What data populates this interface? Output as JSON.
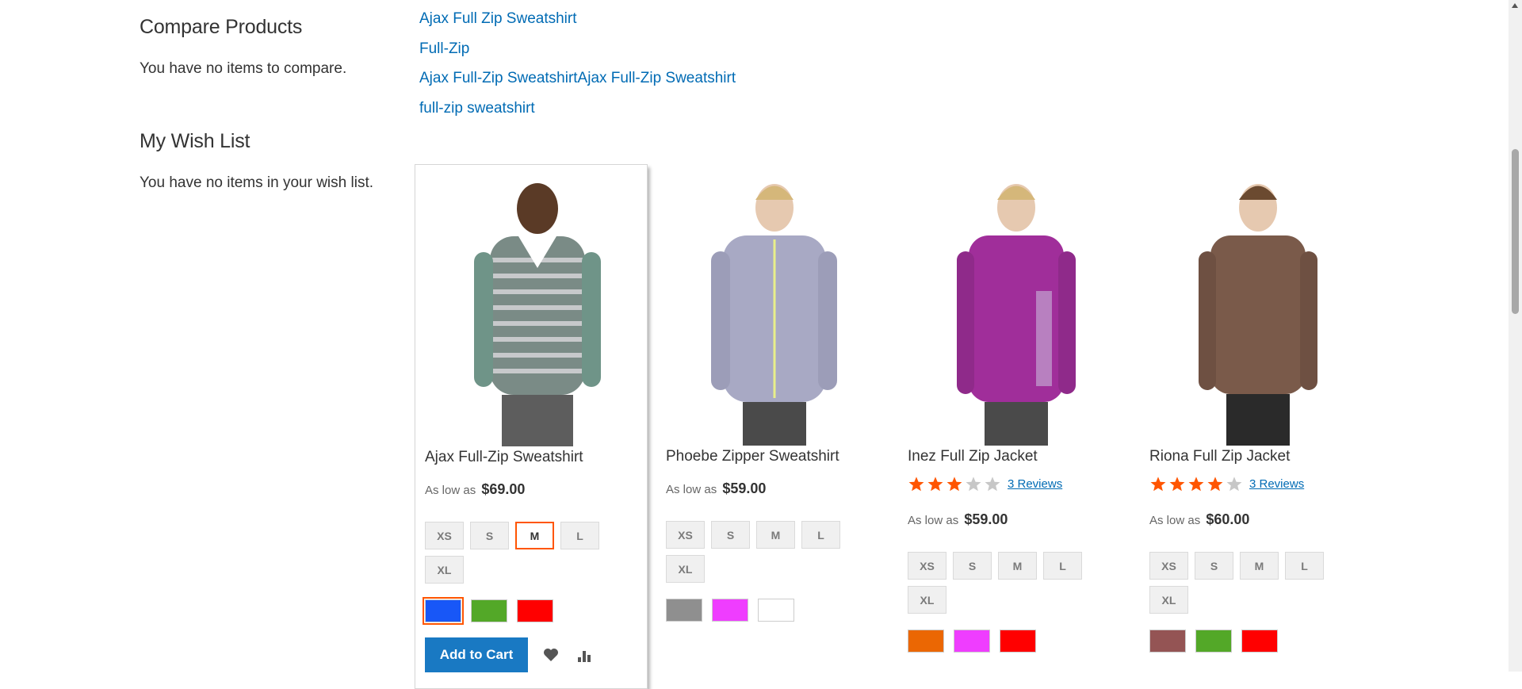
{
  "sidebar": {
    "compare_title": "Compare Products",
    "compare_text": "You have no items to compare.",
    "wishlist_title": "My Wish List",
    "wishlist_text": "You have no items in your wish list."
  },
  "related_searches": [
    "Ajax Full Zip Sweatshirt",
    "Full-Zip",
    "Ajax Full-Zip SweatshirtAjax Full-Zip Sweatshirt",
    "full-zip sweatshirt"
  ],
  "products": [
    {
      "name": "Ajax Full-Zip Sweatshirt",
      "price_prefix": "As low as",
      "price": "$69.00",
      "sizes": [
        "XS",
        "S",
        "M",
        "L",
        "XL"
      ],
      "selected_size": "M",
      "colors": [
        "#1857f7",
        "#53a828",
        "#ff0000"
      ],
      "selected_color_index": 0,
      "add_to_cart": "Add to Cart",
      "wishlist_icon": "heart-icon",
      "compare_icon": "bar-chart-icon"
    },
    {
      "name": "Phoebe Zipper Sweatshirt",
      "price_prefix": "As low as",
      "price": "$59.00",
      "sizes": [
        "XS",
        "S",
        "M",
        "L",
        "XL"
      ],
      "colors": [
        "#8f8f8f",
        "#ef3dff",
        "#ffffff"
      ]
    },
    {
      "name": "Inez Full Zip Jacket",
      "rating_stars": 3,
      "reviews": "3 Reviews",
      "price_prefix": "As low as",
      "price": "$59.00",
      "sizes": [
        "XS",
        "S",
        "M",
        "L",
        "XL"
      ],
      "colors": [
        "#eb6703",
        "#ef3dff",
        "#ff0000"
      ]
    },
    {
      "name": "Riona Full Zip Jacket",
      "rating_stars": 4,
      "reviews": "3 Reviews",
      "price_prefix": "As low as",
      "price": "$60.00",
      "sizes": [
        "XS",
        "S",
        "M",
        "L",
        "XL"
      ],
      "colors": [
        "#945454",
        "#53a828",
        "#ff0000"
      ]
    }
  ]
}
